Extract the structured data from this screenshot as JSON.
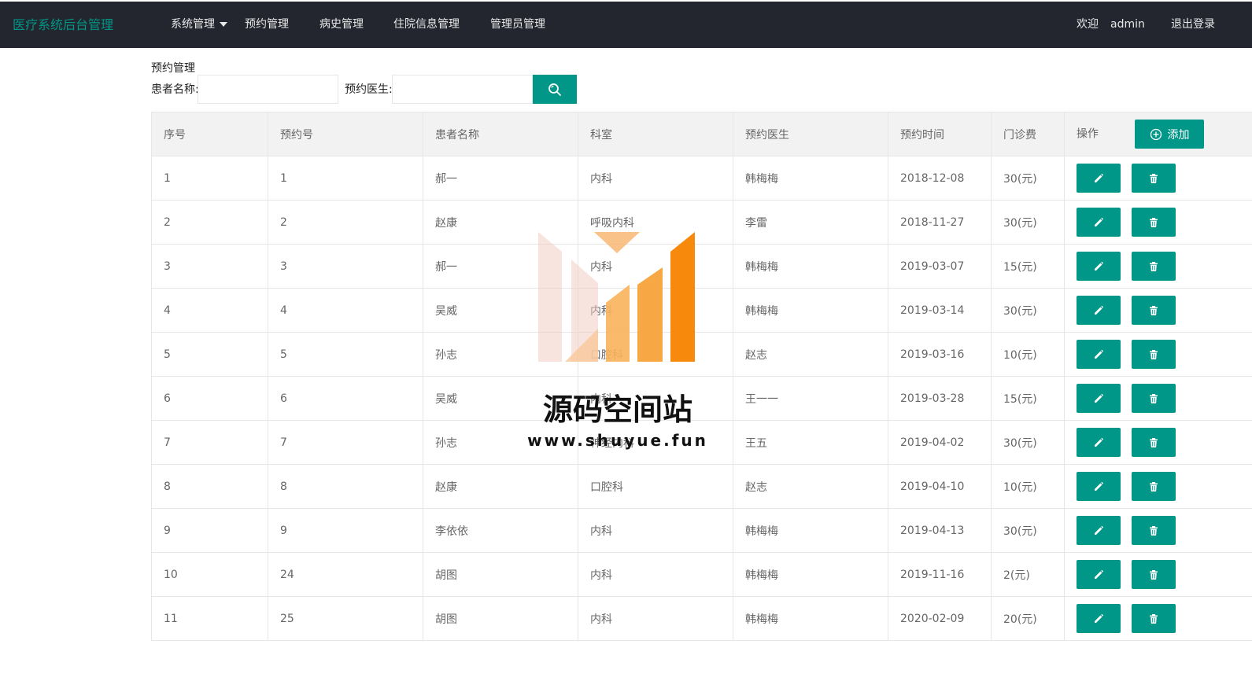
{
  "header": {
    "brand": "医疗系统后台管理",
    "nav": [
      {
        "label": "系统管理"
      },
      {
        "label": "预约管理"
      },
      {
        "label": "病史管理"
      },
      {
        "label": "住院信息管理"
      },
      {
        "label": "管理员管理"
      }
    ],
    "welcome": "欢迎",
    "username": "admin",
    "logout": "退出登录"
  },
  "page": {
    "title": "预约管理",
    "search": {
      "patient_label": "患者名称:",
      "patient_value": "",
      "doctor_label": "预约医生:",
      "doctor_value": ""
    }
  },
  "table": {
    "headers": [
      "序号",
      "预约号",
      "患者名称",
      "科室",
      "预约医生",
      "预约时间",
      "门诊费",
      "操作"
    ],
    "add_label": "添加",
    "rows": [
      [
        "1",
        "1",
        "郝一",
        "内科",
        "韩梅梅",
        "2018-12-08",
        "30(元)"
      ],
      [
        "2",
        "2",
        "赵康",
        "呼吸内科",
        "李雷",
        "2018-11-27",
        "30(元)"
      ],
      [
        "3",
        "3",
        "郝一",
        "内科",
        "韩梅梅",
        "2019-03-07",
        "15(元)"
      ],
      [
        "4",
        "4",
        "吴威",
        "内科",
        "韩梅梅",
        "2019-03-14",
        "30(元)"
      ],
      [
        "5",
        "5",
        "孙志",
        "口腔科",
        "赵志",
        "2019-03-16",
        "10(元)"
      ],
      [
        "6",
        "6",
        "吴威",
        "内科",
        "王一一",
        "2019-03-28",
        "15(元)"
      ],
      [
        "7",
        "7",
        "孙志",
        "神经内科",
        "王五",
        "2019-04-02",
        "30(元)"
      ],
      [
        "8",
        "8",
        "赵康",
        "口腔科",
        "赵志",
        "2019-04-10",
        "10(元)"
      ],
      [
        "9",
        "9",
        "李依依",
        "内科",
        "韩梅梅",
        "2019-04-13",
        "30(元)"
      ],
      [
        "10",
        "24",
        "胡图",
        "内科",
        "韩梅梅",
        "2019-11-16",
        "2(元)"
      ],
      [
        "11",
        "25",
        "胡图",
        "内科",
        "韩梅梅",
        "2020-02-09",
        "20(元)"
      ]
    ]
  },
  "watermark": {
    "title": "源码空间站",
    "url": "www.shuyue.fun"
  },
  "colors": {
    "primary": "#009688",
    "header_bg": "#23262e",
    "table_header_bg": "#f2f2f2",
    "watermark_orange": "#f7890c"
  },
  "icons": {
    "search": "search-icon",
    "edit": "pencil-icon",
    "delete": "trash-icon",
    "add": "plus-circle-icon",
    "dropdown": "caret-down-icon"
  }
}
